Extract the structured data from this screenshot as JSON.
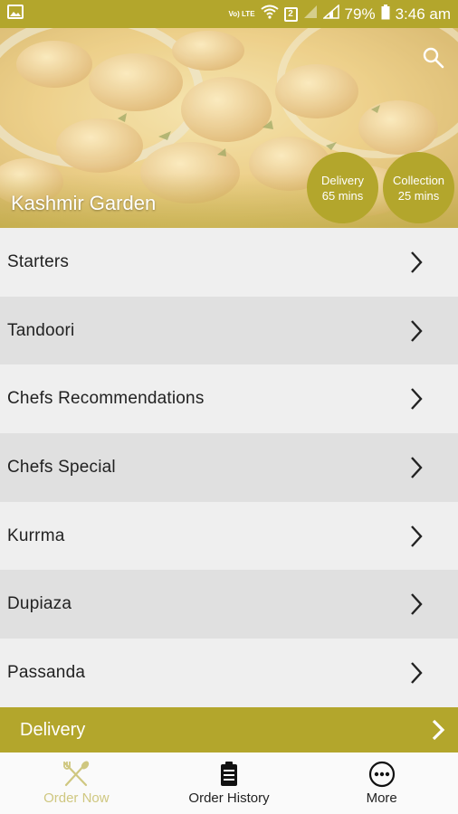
{
  "status_bar": {
    "volte": "Vo) LTE",
    "sim": "2",
    "battery": "79%",
    "time": "3:46 am"
  },
  "hero": {
    "restaurant_name": "Kashmir Garden",
    "delivery": {
      "label": "Delivery",
      "time": "65 mins"
    },
    "collection": {
      "label": "Collection",
      "time": "25 mins"
    }
  },
  "menu": {
    "items": [
      {
        "label": "Starters"
      },
      {
        "label": "Tandoori"
      },
      {
        "label": "Chefs Recommendations"
      },
      {
        "label": "Chefs Special"
      },
      {
        "label": "Kurrma"
      },
      {
        "label": "Dupiaza"
      },
      {
        "label": "Passanda"
      }
    ]
  },
  "delivery_bar": {
    "label": "Delivery"
  },
  "tabs": {
    "order_now": "Order Now",
    "order_history": "Order History",
    "more": "More"
  },
  "colors": {
    "accent": "#b3a62c",
    "active_tab": "#cfc780"
  }
}
